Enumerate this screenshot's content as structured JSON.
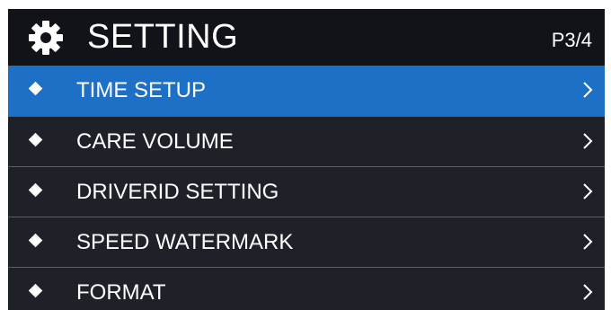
{
  "header": {
    "title": "SETTING",
    "page_indicator": "P3/4",
    "icon": "gear-icon"
  },
  "menu": {
    "items": [
      {
        "label": "TIME SETUP",
        "selected": true
      },
      {
        "label": "CARE VOLUME",
        "selected": false
      },
      {
        "label": "DRIVERID SETTING",
        "selected": false
      },
      {
        "label": "SPEED WATERMARK",
        "selected": false
      },
      {
        "label": "FORMAT",
        "selected": false
      }
    ]
  },
  "colors": {
    "selected": "#1e6fc6",
    "background": "#1f2129",
    "header": "#121318",
    "text": "#ffffff"
  }
}
